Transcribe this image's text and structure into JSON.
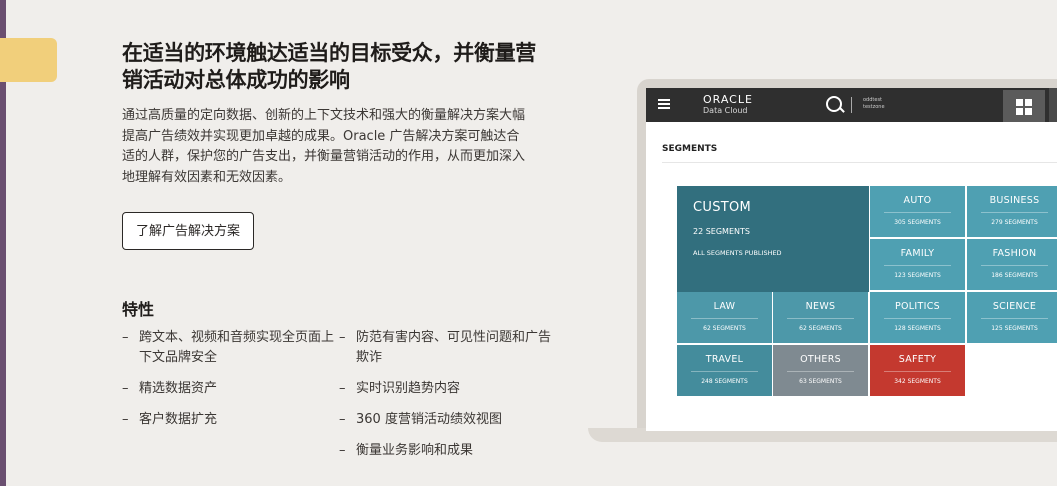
{
  "page": {
    "title": "在适当的环境触达适当的目标受众，并衡量营销活动对总体成功的影响",
    "description": "通过高质量的定向数据、创新的上下文技术和强大的衡量解决方案大幅提高广告绩效并实现更加卓越的成果。Oracle 广告解决方案可触达合适的人群，保护您的广告支出，并衡量营销活动的作用，从而更加深入地理解有效因素和无效因素。",
    "cta_label": "了解广告解决方案"
  },
  "features": {
    "heading": "特性",
    "left": [
      {
        "dash": "–",
        "text": "跨文本、视频和音频实现全页面上下文品牌安全"
      },
      {
        "dash": "–",
        "text": "精选数据资产"
      },
      {
        "dash": "–",
        "text": "客户数据扩充"
      }
    ],
    "right": [
      {
        "dash": "–",
        "text": "防范有害内容、可见性问题和广告欺诈"
      },
      {
        "dash": "–",
        "text": "实时识别趋势内容"
      },
      {
        "dash": "–",
        "text": "360 度营销活动绩效视图"
      },
      {
        "dash": "–",
        "text": "衡量业务影响和成果"
      }
    ]
  },
  "screen": {
    "logo_line1": "ORACLE",
    "logo_line2": "Data Cloud",
    "user_line1": "oddtest",
    "user_line2": "testzone",
    "section_title": "SEGMENTS",
    "custom": {
      "name": "CUSTOM",
      "count": "22 SEGMENTS",
      "status": "ALL SEGMENTS PUBLISHED"
    },
    "segments": [
      {
        "name": "AUTO",
        "count": "305 SEGMENTS",
        "color": "#4fa0b2"
      },
      {
        "name": "BUSINESS",
        "count": "279 SEGMENTS",
        "color": "#4fa0b2"
      },
      {
        "name": "FAMILY",
        "count": "123 SEGMENTS",
        "color": "#4fa0b2"
      },
      {
        "name": "FASHION",
        "count": "186 SEGMENTS",
        "color": "#4fa0b2"
      },
      {
        "name": "LAW",
        "count": "62 SEGMENTS",
        "color": "#4d98a9"
      },
      {
        "name": "NEWS",
        "count": "62 SEGMENTS",
        "color": "#4d98a9"
      },
      {
        "name": "POLITICS",
        "count": "128 SEGMENTS",
        "color": "#4fa0b2"
      },
      {
        "name": "SCIENCE",
        "count": "125 SEGMENTS",
        "color": "#4fa0b2"
      },
      {
        "name": "TRAVEL",
        "count": "248 SEGMENTS",
        "color": "#448c9c"
      },
      {
        "name": "OTHERS",
        "count": "63 SEGMENTS",
        "color": "#7f8a91"
      },
      {
        "name": "SAFETY",
        "count": "342 SEGMENTS",
        "color": "#c4392f"
      }
    ],
    "custom_color": "#326f7e"
  }
}
